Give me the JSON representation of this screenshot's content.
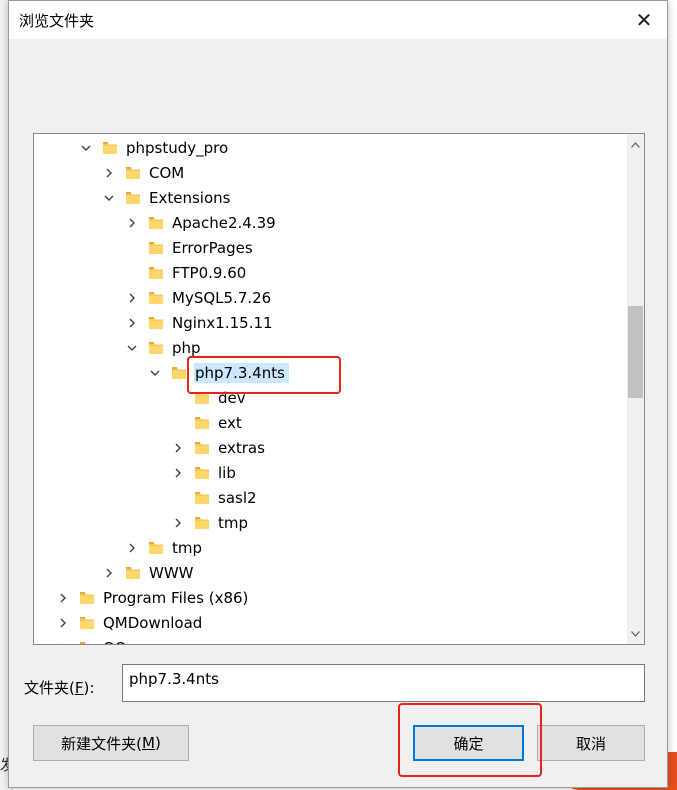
{
  "background": {
    "left_char": "发"
  },
  "dialog": {
    "title": "浏览文件夹",
    "close_glyph": "✕",
    "tree": [
      {
        "label": "phpstudy_pro",
        "indent": 3,
        "state": "expanded"
      },
      {
        "label": "COM",
        "indent": 4,
        "state": "collapsed"
      },
      {
        "label": "Extensions",
        "indent": 4,
        "state": "expanded"
      },
      {
        "label": "Apache2.4.39",
        "indent": 5,
        "state": "collapsed"
      },
      {
        "label": "ErrorPages",
        "indent": 5,
        "state": "leaf"
      },
      {
        "label": "FTP0.9.60",
        "indent": 5,
        "state": "leaf"
      },
      {
        "label": "MySQL5.7.26",
        "indent": 5,
        "state": "collapsed"
      },
      {
        "label": "Nginx1.15.11",
        "indent": 5,
        "state": "collapsed"
      },
      {
        "label": "php",
        "indent": 5,
        "state": "expanded"
      },
      {
        "label": "php7.3.4nts",
        "indent": 6,
        "state": "expanded",
        "selected": true
      },
      {
        "label": "dev",
        "indent": 7,
        "state": "leaf"
      },
      {
        "label": "ext",
        "indent": 7,
        "state": "leaf"
      },
      {
        "label": "extras",
        "indent": 7,
        "state": "collapsed"
      },
      {
        "label": "lib",
        "indent": 7,
        "state": "collapsed"
      },
      {
        "label": "sasl2",
        "indent": 7,
        "state": "leaf"
      },
      {
        "label": "tmp",
        "indent": 7,
        "state": "collapsed"
      },
      {
        "label": "tmp",
        "indent": 5,
        "state": "collapsed"
      },
      {
        "label": "WWW",
        "indent": 4,
        "state": "collapsed"
      },
      {
        "label": "Program Files (x86)",
        "indent": 2,
        "state": "collapsed"
      },
      {
        "label": "QMDownload",
        "indent": 2,
        "state": "collapsed"
      },
      {
        "label": "QQ",
        "indent": 2,
        "state": "collapsed"
      }
    ],
    "folder_field": {
      "label_prefix": "文件夹(",
      "label_key": "F",
      "label_suffix": "):",
      "value": "php7.3.4nts"
    },
    "buttons": {
      "new_folder_prefix": "新建文件夹(",
      "new_folder_key": "M",
      "new_folder_suffix": ")",
      "ok": "确定",
      "cancel": "取消"
    }
  },
  "colors": {
    "folder": "#f7c95a",
    "selection": "#cce8ff",
    "highlight_box": "#e8231e",
    "default_button_border": "#0078d7"
  }
}
